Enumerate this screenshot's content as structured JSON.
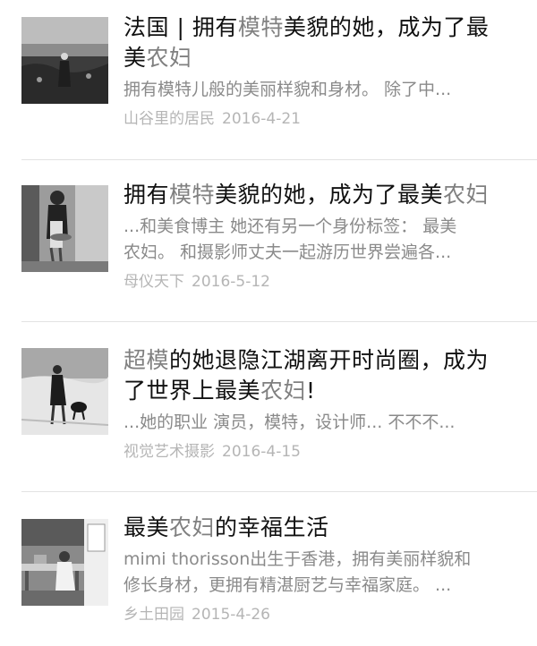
{
  "articles": [
    {
      "title": {
        "segments": [
          {
            "text": "法国 | 拥有",
            "hl": false
          },
          {
            "text": "模特",
            "hl": true
          },
          {
            "text": "美貌的她，成为了最",
            "hl": false
          }
        ],
        "segments2": [
          {
            "text": "美",
            "hl": false
          },
          {
            "text": "农妇",
            "hl": true
          }
        ]
      },
      "snippet1": "拥有模特儿般的美丽样貌和身材。 除了中...",
      "snippet2": "",
      "source": "山谷里的居民",
      "date": "2016-4-21"
    },
    {
      "title": {
        "segments": [
          {
            "text": "拥有",
            "hl": false
          },
          {
            "text": "模特",
            "hl": true
          },
          {
            "text": "美貌的她，成为了最美",
            "hl": false
          },
          {
            "text": "农妇",
            "hl": true
          }
        ],
        "segments2": []
      },
      "snippet1": "...和美食博主 她还有另一个身份标签： 最美",
      "snippet2": "农妇。 和摄影师丈夫一起游历世界尝遍各...",
      "source": "母仪天下",
      "date": "2016-5-12"
    },
    {
      "title": {
        "segments": [
          {
            "text": "超模",
            "hl": true
          },
          {
            "text": "的她退隐江湖离开时尚圈，成为",
            "hl": false
          }
        ],
        "segments2": [
          {
            "text": "了世界上最美",
            "hl": false
          },
          {
            "text": "农妇",
            "hl": true
          },
          {
            "text": "!",
            "hl": false
          }
        ]
      },
      "snippet1": "...她的职业 演员，模特，设计师... 不不不...",
      "snippet2": "",
      "source": "视觉艺术摄影",
      "date": "2016-4-15"
    },
    {
      "title": {
        "segments": [
          {
            "text": "最美",
            "hl": false
          },
          {
            "text": "农妇",
            "hl": true
          },
          {
            "text": "的幸福生活",
            "hl": false
          }
        ],
        "segments2": []
      },
      "snippet1": "mimi thorisson出生于香港，拥有美丽样貌和",
      "snippet2": "修长身材，更拥有精湛厨艺与幸福家庭。 ...",
      "source": "乡土田园",
      "date": "2015-4-26"
    }
  ]
}
